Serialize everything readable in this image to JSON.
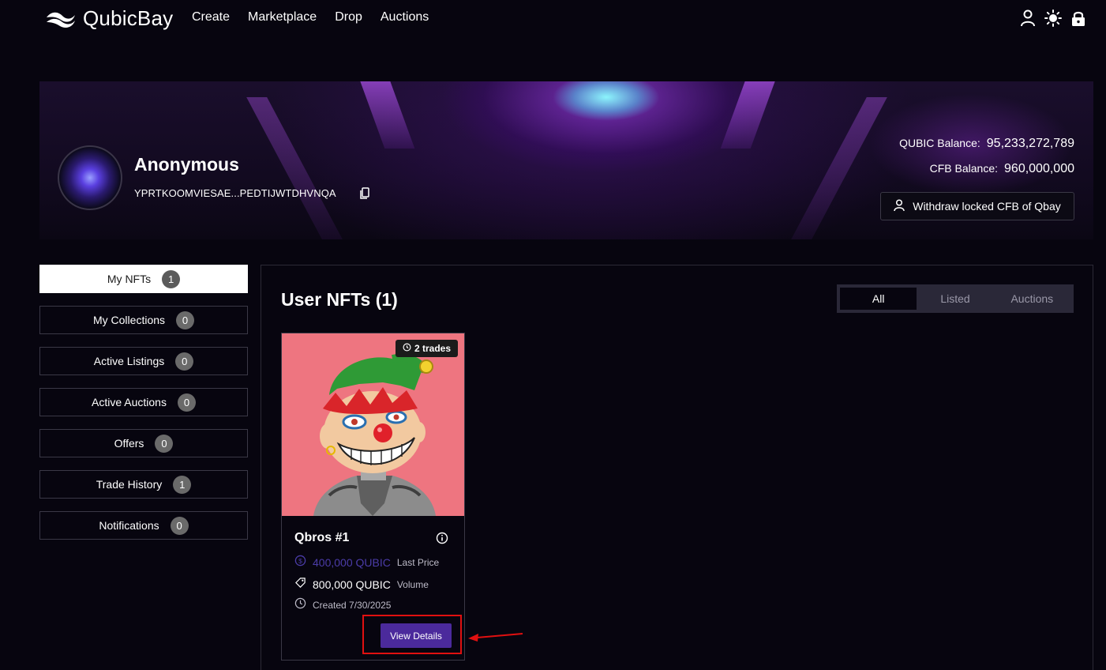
{
  "nav": {
    "brand": "QubicBay",
    "links": [
      "Create",
      "Marketplace",
      "Drop",
      "Auctions"
    ],
    "icons": [
      "user-icon",
      "sun-icon",
      "lock-icon"
    ]
  },
  "profile": {
    "name": "Anonymous",
    "address": "YPRTKOOMVIESAE...PEDTIJWTDHVNQA",
    "qubic_label": "QUBIC Balance:",
    "qubic_value": "95,233,272,789",
    "cfb_label": "CFB Balance:",
    "cfb_value": "960,000,000",
    "withdraw_label": "Withdraw locked CFB of Qbay"
  },
  "sidebar": {
    "items": [
      {
        "label": "My NFTs",
        "count": "1",
        "active": true
      },
      {
        "label": "My Collections",
        "count": "0"
      },
      {
        "label": "Active Listings",
        "count": "0"
      },
      {
        "label": "Active Auctions",
        "count": "0"
      },
      {
        "label": "Offers",
        "count": "0"
      },
      {
        "label": "Trade History",
        "count": "1"
      },
      {
        "label": "Notifications",
        "count": "0"
      }
    ]
  },
  "main": {
    "title": "User NFTs (1)",
    "tabs": [
      "All",
      "Listed",
      "Auctions"
    ],
    "active_tab": "All"
  },
  "card": {
    "trades": "2 trades",
    "title": "Qbros #1",
    "last_price": "400,000 QUBIC",
    "last_price_label": "Last Price",
    "volume": "800,000 QUBIC",
    "volume_label": "Volume",
    "created": "Created 7/30/2025",
    "button": "View Details"
  },
  "colors": {
    "background": "#07050f",
    "accent": "#4b2a9c",
    "card_image_bg": "#ee7580",
    "annotation": "#e01010"
  }
}
